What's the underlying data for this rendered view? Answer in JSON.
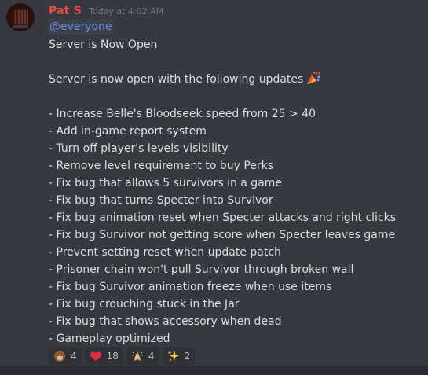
{
  "message": {
    "username": "Pat S",
    "timestamp": "Today at 4:02 AM",
    "mention": "@everyone",
    "title": "Server is Now Open",
    "intro": "Server is now open with the following updates",
    "updates": [
      "- Increase Belle's Bloodseek speed from 25 > 40",
      "- Add in-game report system",
      "- Turn off player's levels visibility",
      "- Remove level requirement to buy Perks",
      "- Fix bug that allows 5 survivors in a game",
      "- Fix bug that turns Specter into Survivor",
      "- Fix bug animation reset when Specter attacks and right clicks",
      "- Fix bug Survivor not getting score when Specter leaves game",
      "- Prevent setting reset when update patch",
      "- Prisoner chain won't pull Survivor through broken wall",
      "- Fix bug Survivor animation freeze when use items",
      "- Fix bug crouching stuck in the Jar",
      "- Fix bug that shows accessory when dead",
      "- Gameplay optimized"
    ],
    "intro_emoji": "party-popper-icon",
    "reactions": [
      {
        "emoji": "monkey-face-icon",
        "count": "4"
      },
      {
        "emoji": "red-heart-icon",
        "count": "18"
      },
      {
        "emoji": "folded-hands-icon",
        "count": "4"
      },
      {
        "emoji": "sparkles-icon",
        "count": "2"
      }
    ]
  },
  "colors": {
    "background": "#36393f",
    "username": "#f04747",
    "mention": "#7289da",
    "text": "#dcddde",
    "timestamp": "#72767d",
    "reaction_bg": "#2f3136"
  }
}
